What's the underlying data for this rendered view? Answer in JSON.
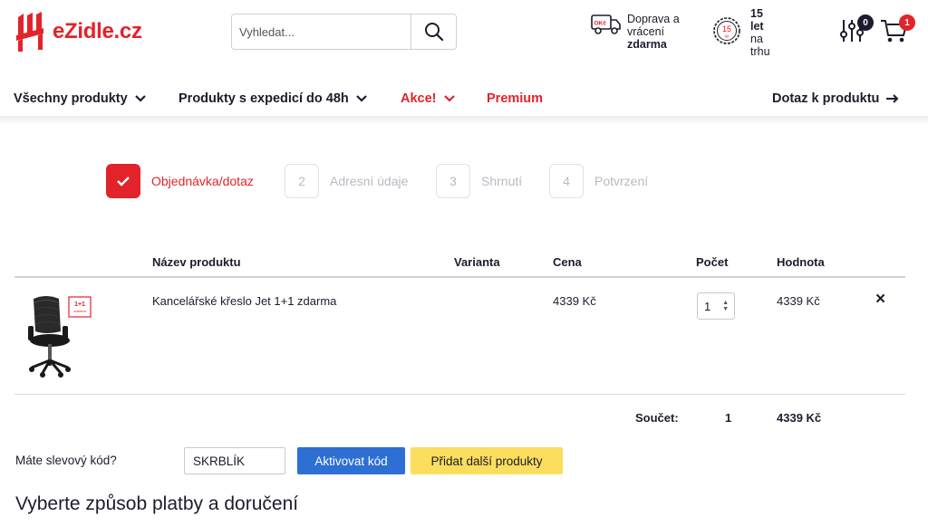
{
  "header": {
    "logo_text": "eZidle.cz",
    "search": {
      "placeholder": "Vyhledat..."
    },
    "shipping": {
      "badge": "OKč",
      "line1": "Doprava a",
      "line2": "vrácení",
      "line3": "zdarma"
    },
    "years": {
      "seal": "15",
      "seal_small": "let",
      "line1": "15",
      "line2": "let",
      "line3": "na",
      "line4": "trhu"
    },
    "compare_count": "0",
    "cart_count": "1"
  },
  "nav": {
    "all_products": "Všechny produkty",
    "express": "Produkty s expedicí do 48h",
    "sale": "Akce!",
    "premium": "Premium",
    "inquiry": "Dotaz k produktu"
  },
  "steps": [
    {
      "number": "",
      "label": "Objednávka/dotaz"
    },
    {
      "number": "2",
      "label": "Adresní údaje"
    },
    {
      "number": "3",
      "label": "Shrnutí"
    },
    {
      "number": "4",
      "label": "Potvrzení"
    }
  ],
  "table": {
    "headers": {
      "name": "Název produktu",
      "variant": "Varianta",
      "price": "Cena",
      "qty": "Počet",
      "total": "Hodnota"
    },
    "rows": [
      {
        "badge": "1+1",
        "badge_small": "zdarma",
        "name": "Kancelářské křeslo Jet 1+1 zdarma",
        "variant": "",
        "price": "4339 Kč",
        "qty": "1",
        "total": "4339 Kč",
        "remove": "×"
      }
    ],
    "sum": {
      "label": "Součet:",
      "qty": "1",
      "total": "4339 Kč"
    }
  },
  "discount": {
    "label": "Máte slevový kód?",
    "value": "SKRBLÍK",
    "activate": "Aktivovat kód",
    "add_more": "Přidat další produkty"
  },
  "section_title": "Vyberte způsob platby a doručení",
  "colors": {
    "brand_red": "#e2232a",
    "navy": "#1c1c2e",
    "blue": "#2e6fd4",
    "yellow": "#fbde5e"
  }
}
